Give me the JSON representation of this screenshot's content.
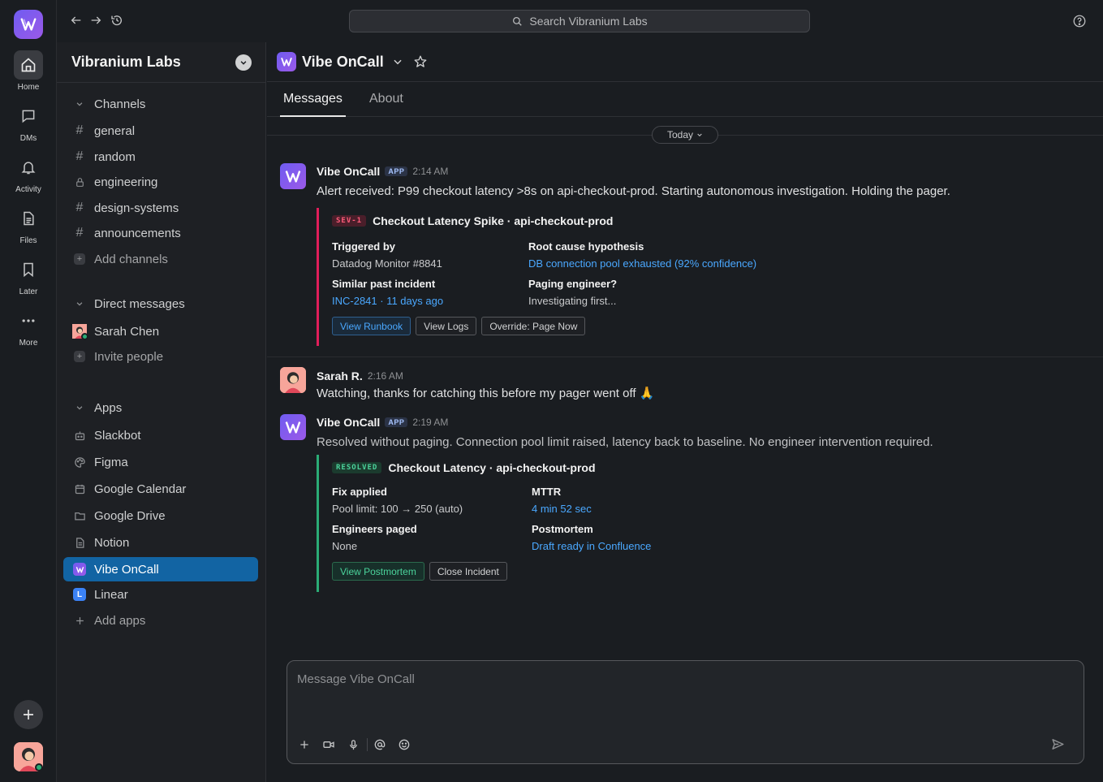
{
  "search": {
    "placeholder": "Search Vibranium Labs"
  },
  "rail": {
    "items": [
      {
        "label": "Home",
        "icon": "home-icon"
      },
      {
        "label": "DMs",
        "icon": "chat-icon"
      },
      {
        "label": "Activity",
        "icon": "bell-icon"
      },
      {
        "label": "Files",
        "icon": "file-icon"
      },
      {
        "label": "Later",
        "icon": "bookmark-icon"
      },
      {
        "label": "More",
        "icon": "ellipsis-icon"
      }
    ]
  },
  "sidebar": {
    "workspace": "Vibranium Labs",
    "channels_header": "Channels",
    "channels": [
      "general",
      "random",
      "engineering",
      "design-systems",
      "announcements"
    ],
    "add_channels": "Add channels",
    "dm_header": "Direct messages",
    "dms": [
      "Sarah Chen"
    ],
    "invite": "Invite people",
    "apps_header": "Apps",
    "apps": [
      "Slackbot",
      "Figma",
      "Google Calendar",
      "Google Drive",
      "Notion",
      "Vibe OnCall",
      "Linear"
    ],
    "add_apps": "Add apps",
    "linear_glyph": "L"
  },
  "channel": {
    "title": "Vibe OnCall",
    "tabs": [
      "Messages",
      "About"
    ],
    "today": "Today"
  },
  "messages": [
    {
      "sender": "Vibe OnCall",
      "badge": "APP",
      "time": "2:14 AM",
      "text": "Alert received: P99 checkout latency >8s on api-checkout-prod. Starting autonomous investigation. Holding the pager.",
      "card": {
        "tag": "SEV-1",
        "title": "Checkout Latency Spike · api-checkout-prod",
        "fields": [
          {
            "label": "Triggered by",
            "value": "Datadog Monitor #8841"
          },
          {
            "label": "Root cause hypothesis",
            "value": "DB connection pool exhausted (92% confidence)"
          },
          {
            "label": "Similar past incident",
            "value": "INC-2841 · 11 days ago"
          },
          {
            "label": "Paging engineer?",
            "value": "Investigating first..."
          }
        ],
        "buttons": [
          "View Runbook",
          "View Logs",
          "Override: Page Now"
        ]
      }
    },
    {
      "sender": "Sarah R.",
      "time": "2:16 AM",
      "text": "Watching, thanks for catching this before my pager went off 🙏"
    },
    {
      "sender": "Vibe OnCall",
      "badge": "APP",
      "time": "2:19 AM",
      "text": "Resolved without paging. Connection pool limit raised, latency back to baseline. No engineer intervention required.",
      "card": {
        "tag": "RESOLVED",
        "title": "Checkout Latency · api-checkout-prod",
        "fields": [
          {
            "label": "Fix applied",
            "value": "Pool limit: 100 → 250 (auto)"
          },
          {
            "label": "MTTR",
            "value": "4 min 52 sec"
          },
          {
            "label": "Engineers paged",
            "value": "None"
          },
          {
            "label": "Postmortem",
            "value": "Draft ready in Confluence"
          }
        ],
        "buttons": [
          "View Postmortem",
          "Close Incident"
        ]
      }
    }
  ],
  "composer": {
    "placeholder": "Message Vibe OnCall"
  },
  "colors": {
    "accent": "#1264a3",
    "sev": "#e01e5a",
    "resolved": "#2bac76",
    "link": "#4aa8ff",
    "brand": "#7b5cf0"
  }
}
